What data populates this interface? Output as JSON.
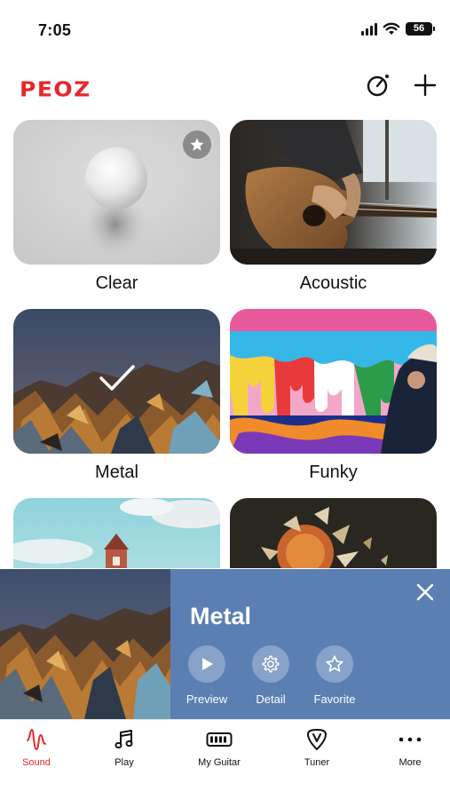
{
  "status_bar": {
    "time": "7:05",
    "battery": "56"
  },
  "header": {
    "logo": "PEOZ",
    "tuner_icon": "tone-dial-icon",
    "add_icon": "plus-icon"
  },
  "presets": [
    {
      "name": "Clear",
      "favorite": true
    },
    {
      "name": "Acoustic",
      "favorite": false
    },
    {
      "name": "Metal",
      "selected": true
    },
    {
      "name": "Funky"
    },
    {
      "name": ""
    },
    {
      "name": ""
    }
  ],
  "panel": {
    "title": "Metal",
    "actions": [
      {
        "label": "Preview",
        "icon": "play-icon"
      },
      {
        "label": "Detail",
        "icon": "gear-icon"
      },
      {
        "label": "Favorite",
        "icon": "star-icon"
      }
    ]
  },
  "tabs": [
    {
      "label": "Sound",
      "icon": "waveform-icon",
      "active": true
    },
    {
      "label": "Play",
      "icon": "music-note-icon"
    },
    {
      "label": "My Guitar",
      "icon": "amp-icon"
    },
    {
      "label": "Tuner",
      "icon": "tuner-pick-icon"
    },
    {
      "label": "More",
      "icon": "more-dots-icon"
    }
  ],
  "colors": {
    "brand_red": "#e6262c",
    "panel_blue": "#5b7fb3",
    "tab_active": "#e6262c"
  }
}
